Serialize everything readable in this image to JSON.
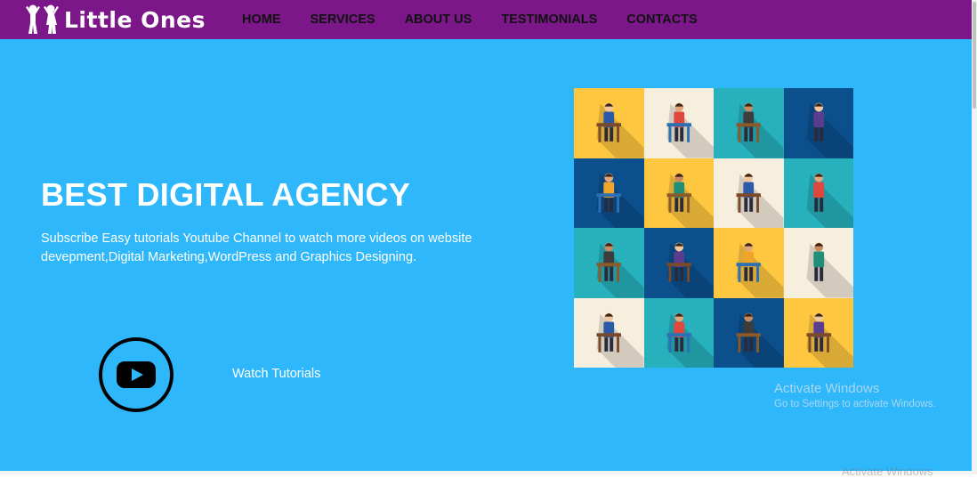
{
  "brand": {
    "name": "Little Ones",
    "icon": "kids-icon",
    "color": "#7b1789"
  },
  "nav": {
    "items": [
      "HOME",
      "SERVICES",
      "ABOUT US",
      "TESTIMONIALS",
      "CONTACTS"
    ]
  },
  "hero": {
    "title": "BEST DIGITAL AGENCY",
    "subtitle": "Subscribe Easy tutorials Youtube Channel to watch more videos on website devepment,Digital Marketing,WordPress and Graphics Designing.",
    "play_icon": "youtube-play-icon",
    "watch_label": "Watch Tutorials",
    "background": "#2eb7fb",
    "illustration": {
      "name": "people-mosaic",
      "tile_colors": [
        "#ffc73f",
        "#f7efde",
        "#26b1bd",
        "#0b4f8d",
        "#0b4f8d",
        "#ffc73f",
        "#f7efde",
        "#26b1bd",
        "#26b1bd",
        "#0b4f8d",
        "#ffc73f",
        "#f7efde",
        "#f7efde",
        "#26b1bd",
        "#0b4f8d",
        "#ffc73f"
      ]
    }
  },
  "watermark": {
    "title": "Activate Windows",
    "subtitle": "Go to Settings to activate Windows.",
    "ghost": "Activate Windows"
  }
}
